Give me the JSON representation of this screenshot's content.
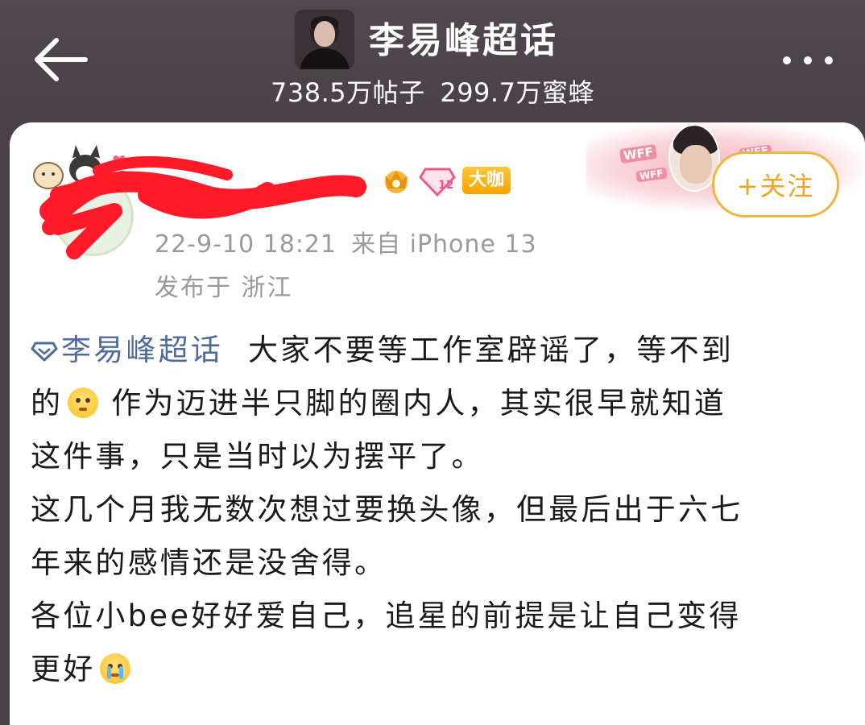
{
  "header": {
    "title": "李易峰超话",
    "posts_count": "738.5万帖子",
    "fans_count": "299.7万蜜蜂"
  },
  "post": {
    "badge_label": "大咖",
    "level_number": "12",
    "timestamp": "22-9-10 18:21",
    "source": "来自 iPhone 13",
    "location": "发布于 浙江",
    "follow_label": "+关注",
    "banner_label": "WFF",
    "content": {
      "topic": "李易峰超话",
      "line1_rest": "大家不要等工作室辟谣了，等不到",
      "line2_start": "的",
      "line2_rest": "作为迈进半只脚的圈内人，其实很早就知道",
      "line3": "这件事，只是当时以为摆平了。",
      "line4": "这几个月我无数次想过要换头像，但最后出于六七",
      "line5": "年来的感情还是没舍得。",
      "line6": "各位小bee好好爱自己，追星的前提是让自己变得",
      "line7_start": "更好"
    }
  },
  "colors": {
    "header_bg": "#4a4048",
    "topic_link": "#506c9c",
    "follow_accent": "#f0a422",
    "meta_gray": "#9a9a9a",
    "redaction_red": "#ff1a2a"
  },
  "icons": {
    "back": "arrow-left-icon",
    "more": "more-dots-icon",
    "topic_diamond": "diamond-icon",
    "crown": "crown-badge-icon",
    "level": "level-diamond-icon",
    "emoji_pleading": "pleading-face-emoji",
    "emoji_crying": "crying-face-emoji"
  }
}
